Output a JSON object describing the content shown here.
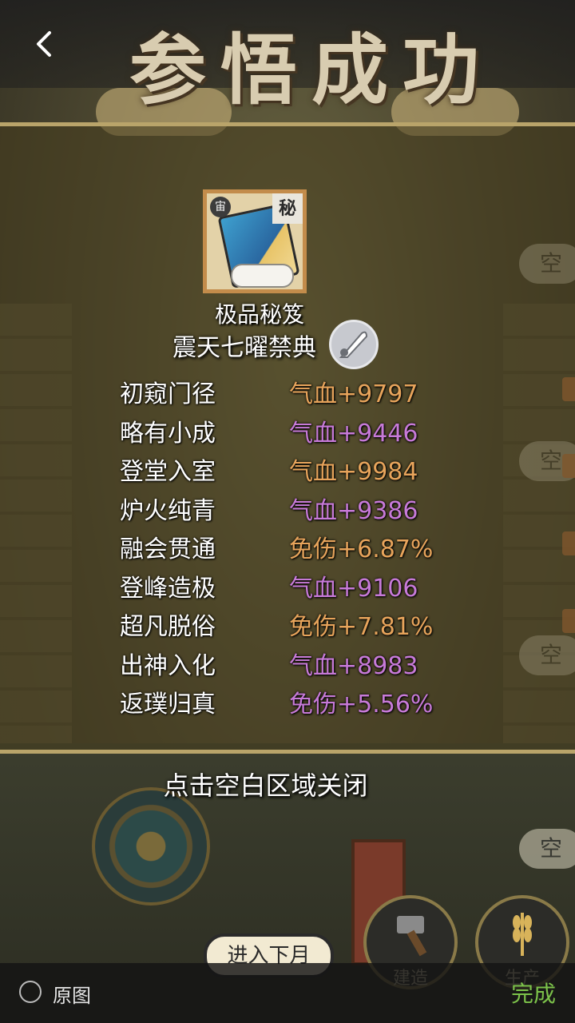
{
  "banner": {
    "title": "参悟成功"
  },
  "item": {
    "badge_left": "宙",
    "badge_right": "秘",
    "type_label": "极品秘笈",
    "name": "震天七曜禁典"
  },
  "stats": [
    {
      "label": "初窥门径",
      "value": "气血+9797",
      "color": "#e7a45b"
    },
    {
      "label": "略有小成",
      "value": "气血+9446",
      "color": "#c77ad8"
    },
    {
      "label": "登堂入室",
      "value": "气血+9984",
      "color": "#e7a45b"
    },
    {
      "label": "炉火纯青",
      "value": "气血+9386",
      "color": "#c77ad8"
    },
    {
      "label": "融会贯通",
      "value": "免伤+6.87%",
      "color": "#e7a45b"
    },
    {
      "label": "登峰造极",
      "value": "气血+9106",
      "color": "#c77ad8"
    },
    {
      "label": "超凡脱俗",
      "value": "免伤+7.81%",
      "color": "#e7a45b"
    },
    {
      "label": "出神入化",
      "value": "气血+8983",
      "color": "#c77ad8"
    },
    {
      "label": "返璞归真",
      "value": "免伤+5.56%",
      "color": "#c77ad8"
    }
  ],
  "close_hint": "点击空白区域关闭",
  "game": {
    "next_month": "进入下月",
    "build": "建造",
    "produce": "生产",
    "side_pill": "空"
  },
  "viewer": {
    "original_label": "原图",
    "done_label": "完成"
  },
  "colors": {
    "accent_green": "#7cc24a",
    "orange": "#e7a45b",
    "purple": "#c77ad8"
  }
}
